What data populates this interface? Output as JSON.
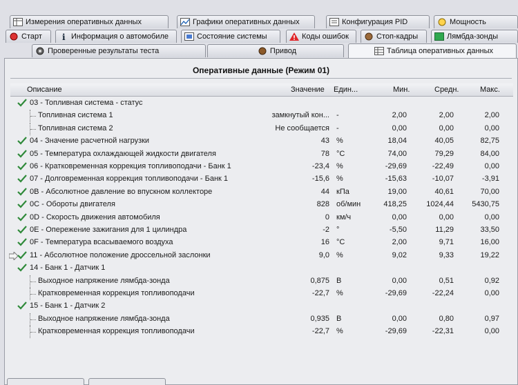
{
  "tabs": {
    "row1": [
      "Измерения оперативных данных",
      "Графики оперативных данных",
      "Конфигурация PID",
      "Мощность"
    ],
    "row2": [
      "Старт",
      "Информация о автомобиле",
      "Состояние системы",
      "Коды ошибок",
      "Стоп-кадры",
      "Лямбда-зонды"
    ],
    "row3": [
      "Проверенные результаты теста",
      "Привод",
      "Таблица оперативных данных"
    ]
  },
  "panel": {
    "title": "Оперативные данные (Режим 01)",
    "columns": {
      "description": "Описание",
      "value": "Значение",
      "unit": "Един...",
      "min": "Мин.",
      "avg": "Средн.",
      "max": "Макс."
    }
  },
  "rows": [
    {
      "desc": "03 - Топливная система - статус",
      "value": "",
      "unit": "",
      "min": "",
      "avg": "",
      "max": "",
      "check": true,
      "level": 0
    },
    {
      "desc": "Топливная система 1",
      "value": "замкнутый кон...",
      "unit": "-",
      "min": "2,00",
      "avg": "2,00",
      "max": "2,00",
      "check": false,
      "level": 1
    },
    {
      "desc": "Топливная система 2",
      "value": "Не сообщается",
      "unit": "-",
      "min": "0,00",
      "avg": "0,00",
      "max": "0,00",
      "check": false,
      "level": 1
    },
    {
      "desc": "04 - Значение расчетной нагрузки",
      "value": "43",
      "unit": "%",
      "min": "18,04",
      "avg": "40,05",
      "max": "82,75",
      "check": true,
      "level": 0
    },
    {
      "desc": "05 - Температура охлаждающей жидкости двигателя",
      "value": "78",
      "unit": "°C",
      "min": "74,00",
      "avg": "79,29",
      "max": "84,00",
      "check": true,
      "level": 0
    },
    {
      "desc": "06 - Кратковременная коррекция топливоподачи - Банк 1",
      "value": "-23,4",
      "unit": "%",
      "min": "-29,69",
      "avg": "-22,49",
      "max": "0,00",
      "check": true,
      "level": 0
    },
    {
      "desc": "07 - Долговременная коррекция топливоподачи - Банк 1",
      "value": "-15,6",
      "unit": "%",
      "min": "-15,63",
      "avg": "-10,07",
      "max": "-3,91",
      "check": true,
      "level": 0
    },
    {
      "desc": "0B - Абсолютное давление во впускном коллекторе",
      "value": "44",
      "unit": "кПа",
      "min": "19,00",
      "avg": "40,61",
      "max": "70,00",
      "check": true,
      "level": 0
    },
    {
      "desc": "0C - Обороты двигателя",
      "value": "828",
      "unit": "об/мин",
      "min": "418,25",
      "avg": "1024,44",
      "max": "5430,75",
      "check": true,
      "level": 0
    },
    {
      "desc": "0D - Скорость движения автомобиля",
      "value": "0",
      "unit": "км/ч",
      "min": "0,00",
      "avg": "0,00",
      "max": "0,00",
      "check": true,
      "level": 0
    },
    {
      "desc": "0E - Опережение зажигания для 1 цилиндра",
      "value": "-2",
      "unit": "°",
      "min": "-5,50",
      "avg": "11,29",
      "max": "33,50",
      "check": true,
      "level": 0
    },
    {
      "desc": "0F - Температура всасываемого воздуха",
      "value": "16",
      "unit": "°C",
      "min": "2,00",
      "avg": "9,71",
      "max": "16,00",
      "check": true,
      "level": 0
    },
    {
      "desc": "11 - Абсолютное положение дроссельной заслонки",
      "value": "9,0",
      "unit": "%",
      "min": "9,02",
      "avg": "9,33",
      "max": "19,22",
      "check": true,
      "level": 0,
      "pointer": true
    },
    {
      "desc": "14 - Банк 1 - Датчик 1",
      "value": "",
      "unit": "",
      "min": "",
      "avg": "",
      "max": "",
      "check": true,
      "level": 0
    },
    {
      "desc": "Выходное напряжение лямбда-зонда",
      "value": "0,875",
      "unit": "В",
      "min": "0,00",
      "avg": "0,51",
      "max": "0,92",
      "check": false,
      "level": 1
    },
    {
      "desc": "Кратковременная коррекция топливоподачи",
      "value": "-22,7",
      "unit": "%",
      "min": "-29,69",
      "avg": "-22,24",
      "max": "0,00",
      "check": false,
      "level": 1
    },
    {
      "desc": "15 - Банк 1 - Датчик 2",
      "value": "",
      "unit": "",
      "min": "",
      "avg": "",
      "max": "",
      "check": true,
      "level": 0
    },
    {
      "desc": "Выходное напряжение лямбда-зонда",
      "value": "0,935",
      "unit": "В",
      "min": "0,00",
      "avg": "0,80",
      "max": "0,97",
      "check": false,
      "level": 1
    },
    {
      "desc": "Кратковременная коррекция топливоподачи",
      "value": "-22,7",
      "unit": "%",
      "min": "-29,69",
      "avg": "-22,31",
      "max": "0,00",
      "check": false,
      "level": 1
    }
  ],
  "colors": {
    "check": "#2f8a3a"
  }
}
